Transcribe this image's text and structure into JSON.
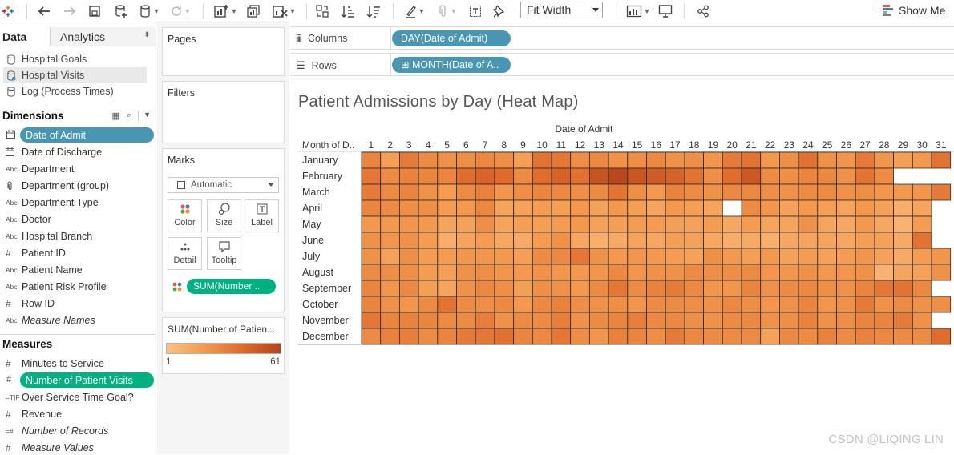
{
  "toolbar": {
    "fit": "Fit Width",
    "show_me": "Show Me",
    "icons": [
      "tableau-logo-icon",
      "undo-icon",
      "redo-icon",
      "save-icon",
      "new-datasource-icon",
      "datasource-icon",
      "refresh-icon",
      "new-worksheet-icon",
      "duplicate-icon",
      "clear-icon",
      "swap-icon",
      "sort-ascending-icon",
      "sort-descending-icon",
      "highlight-icon",
      "group-icon",
      "label-icon",
      "pin-icon",
      "fit-select",
      "chart-icon",
      "presentation-icon",
      "share-icon",
      "show-me-icon"
    ]
  },
  "data_pane": {
    "tab_data": "Data",
    "tab_analytics": "Analytics",
    "datasources": [
      {
        "label": "Hospital Goals",
        "selected": false
      },
      {
        "label": "Hospital Visits",
        "selected": true
      },
      {
        "label": "Log (Process Times)",
        "selected": false
      }
    ],
    "dimensions_title": "Dimensions",
    "dimensions": [
      {
        "icon": "calendar",
        "label": "Date of Admit",
        "style": "pill-blue"
      },
      {
        "icon": "calendar",
        "label": "Date of Discharge",
        "style": ""
      },
      {
        "icon": "abc",
        "label": "Department",
        "style": ""
      },
      {
        "icon": "clip",
        "label": "Department (group)",
        "style": ""
      },
      {
        "icon": "abc",
        "label": "Department Type",
        "style": ""
      },
      {
        "icon": "abc",
        "label": "Doctor",
        "style": ""
      },
      {
        "icon": "abc",
        "label": "Hospital Branch",
        "style": ""
      },
      {
        "icon": "hash",
        "label": "Patient ID",
        "style": ""
      },
      {
        "icon": "abc",
        "label": "Patient Name",
        "style": ""
      },
      {
        "icon": "abc",
        "label": "Patient Risk Profile",
        "style": ""
      },
      {
        "icon": "hash",
        "label": "Row ID",
        "style": ""
      },
      {
        "icon": "abc",
        "label": "Measure Names",
        "style": "italic"
      }
    ],
    "measures_title": "Measures",
    "measures": [
      {
        "icon": "hash",
        "label": "Minutes to Service",
        "style": ""
      },
      {
        "icon": "hash",
        "label": "Number of Patient Visits",
        "style": "pill-green"
      },
      {
        "icon": "tf",
        "label": "Over Service Time Goal?",
        "style": ""
      },
      {
        "icon": "hash",
        "label": "Revenue",
        "style": ""
      },
      {
        "icon": "hash-eq",
        "label": "Number of Records",
        "style": "italic"
      },
      {
        "icon": "hash",
        "label": "Measure Values",
        "style": "italic"
      }
    ]
  },
  "cards": {
    "pages": "Pages",
    "filters": "Filters",
    "marks": "Marks",
    "mark_type": "Automatic",
    "color": "Color",
    "size": "Size",
    "label": "Label",
    "detail": "Detail",
    "tooltip": "Tooltip",
    "color_pill": "SUM(Number ..",
    "legend_title": "SUM(Number of Patien...",
    "legend_min": "1",
    "legend_max": "61"
  },
  "shelves": {
    "columns_label": "Columns",
    "columns_pill": "DAY(Date of Admit)",
    "rows_label": "Rows",
    "rows_pill": "MONTH(Date of A..",
    "rows_pill_prefix": "⊞"
  },
  "chart_data": {
    "type": "heatmap",
    "title": "Patient Admissions by Day (Heat Map)",
    "x_header": "Date of Admit",
    "y_header": "Month of D..",
    "x_categories": [
      "1",
      "2",
      "3",
      "4",
      "5",
      "6",
      "7",
      "8",
      "9",
      "10",
      "11",
      "12",
      "13",
      "14",
      "15",
      "16",
      "17",
      "18",
      "19",
      "20",
      "21",
      "22",
      "23",
      "24",
      "25",
      "26",
      "27",
      "28",
      "29",
      "30",
      "31"
    ],
    "y_categories": [
      "January",
      "February",
      "March",
      "April",
      "May",
      "June",
      "July",
      "August",
      "September",
      "October",
      "November",
      "December"
    ],
    "colorscale": {
      "min": 1,
      "max": 61,
      "colors": [
        "#fdc086",
        "#f2994e",
        "#de6a2c",
        "#b2431c"
      ]
    },
    "values": [
      [
        30,
        22,
        33,
        28,
        26,
        27,
        29,
        27,
        22,
        35,
        34,
        27,
        29,
        26,
        27,
        29,
        26,
        27,
        25,
        33,
        35,
        24,
        27,
        36,
        26,
        25,
        33,
        25,
        22,
        24,
        35
      ],
      [
        34,
        28,
        31,
        30,
        30,
        37,
        40,
        38,
        28,
        37,
        41,
        36,
        46,
        50,
        45,
        43,
        41,
        35,
        27,
        37,
        44,
        28,
        27,
        30,
        29,
        26,
        35,
        28,
        null,
        null,
        null
      ],
      [
        33,
        28,
        30,
        26,
        23,
        28,
        31,
        25,
        27,
        30,
        29,
        27,
        28,
        35,
        27,
        24,
        31,
        28,
        26,
        29,
        29,
        27,
        26,
        28,
        28,
        26,
        27,
        25,
        24,
        25,
        33
      ],
      [
        30,
        28,
        27,
        27,
        23,
        24,
        29,
        20,
        21,
        23,
        22,
        24,
        21,
        24,
        22,
        20,
        24,
        22,
        20,
        null,
        28,
        25,
        21,
        24,
        22,
        20,
        24,
        21,
        17,
        20,
        null
      ],
      [
        24,
        24,
        25,
        24,
        20,
        21,
        27,
        20,
        22,
        22,
        23,
        24,
        21,
        22,
        23,
        23,
        22,
        21,
        23,
        19,
        23,
        20,
        20,
        26,
        20,
        19,
        24,
        19,
        15,
        23,
        null
      ],
      [
        26,
        25,
        26,
        23,
        17,
        20,
        23,
        19,
        18,
        23,
        26,
        19,
        16,
        18,
        20,
        19,
        22,
        21,
        19,
        17,
        18,
        16,
        19,
        20,
        20,
        19,
        22,
        21,
        18,
        35,
        null
      ],
      [
        26,
        21,
        27,
        23,
        23,
        25,
        25,
        24,
        22,
        28,
        29,
        34,
        26,
        24,
        25,
        24,
        23,
        21,
        27,
        24,
        22,
        24,
        21,
        23,
        21,
        23,
        25,
        21,
        18,
        23,
        25
      ],
      [
        28,
        27,
        27,
        23,
        22,
        26,
        27,
        25,
        24,
        26,
        25,
        24,
        25,
        29,
        25,
        26,
        26,
        28,
        27,
        27,
        28,
        25,
        25,
        26,
        24,
        25,
        26,
        15,
        20,
        21,
        26
      ],
      [
        30,
        25,
        29,
        22,
        20,
        26,
        29,
        27,
        22,
        27,
        26,
        24,
        28,
        34,
        28,
        31,
        33,
        29,
        25,
        25,
        30,
        26,
        28,
        29,
        27,
        26,
        30,
        34,
        35,
        29,
        null
      ],
      [
        30,
        26,
        25,
        28,
        35,
        28,
        27,
        29,
        24,
        29,
        31,
        27,
        26,
        27,
        25,
        28,
        28,
        27,
        26,
        29,
        27,
        25,
        26,
        30,
        25,
        26,
        33,
        26,
        28,
        26,
        27
      ],
      [
        34,
        30,
        31,
        30,
        28,
        28,
        32,
        26,
        28,
        28,
        32,
        26,
        28,
        30,
        32,
        29,
        29,
        27,
        26,
        28,
        29,
        26,
        27,
        31,
        26,
        27,
        30,
        30,
        33,
        26,
        null
      ],
      [
        28,
        31,
        32,
        28,
        30,
        33,
        34,
        36,
        30,
        29,
        34,
        27,
        25,
        31,
        30,
        27,
        33,
        29,
        28,
        28,
        28,
        21,
        29,
        28,
        31,
        28,
        31,
        29,
        28,
        28,
        37
      ]
    ]
  },
  "watermark": "CSDN @LIQING LIN"
}
